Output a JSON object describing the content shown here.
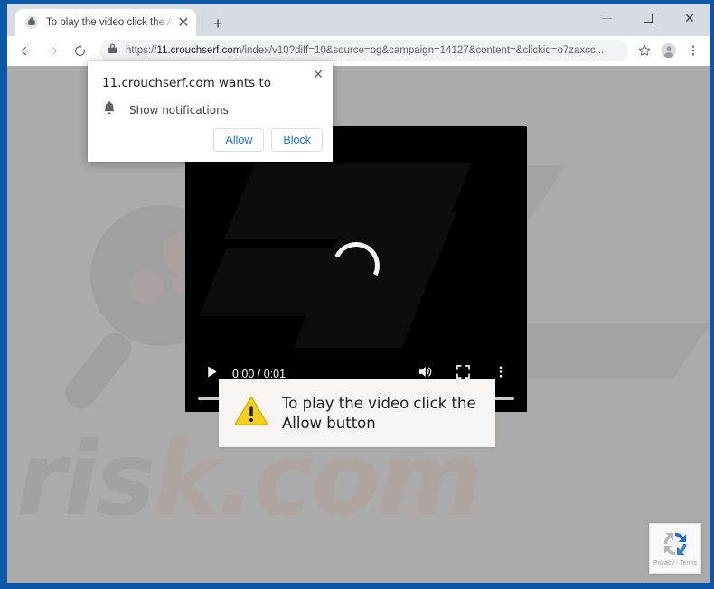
{
  "browser": {
    "tab": {
      "title": "To play the video click the Allow",
      "favicon": "globe-icon",
      "close_label": "✕"
    },
    "new_tab_label": "+",
    "window_controls": {
      "minimize": "minimize-icon",
      "maximize": "maximize-icon",
      "close": "✕"
    },
    "toolbar": {
      "back": "back-arrow-icon",
      "forward": "forward-arrow-icon",
      "reload": "reload-icon",
      "lock": "lock-icon",
      "url_scheme": "https://",
      "url_host": "11.crouchserf.com",
      "url_path": "/index/v10?diff=10&source=og&campaign=14127&content=&clickid=o7zaxcc...",
      "url_full": "https://11.crouchserf.com/index/v10?diff=10&source=og&campaign=14127&content=&clickid=o7zaxcc...",
      "bookmark": "star-icon",
      "profile": "profile-avatar-icon",
      "menu": "three-dot-menu-icon"
    }
  },
  "permission_dialog": {
    "title": "11.crouchserf.com wants to",
    "option_icon": "bell-icon",
    "option_label": "Show notifications",
    "allow_label": "Allow",
    "block_label": "Block",
    "close_label": "✕"
  },
  "video": {
    "play_icon": "play-icon",
    "time_display": "0:00 / 0:01",
    "current_time": "0:00",
    "duration": "0:01",
    "volume_icon": "volume-icon",
    "fullscreen_icon": "fullscreen-icon",
    "options_icon": "three-dot-vertical-icon",
    "spinner": "loading-spinner-icon",
    "progress_percent": 0
  },
  "message_box": {
    "icon": "warning-triangle-icon",
    "line1": "To play the video click the",
    "line2": "Allow button",
    "text": "To play the video click the Allow button"
  },
  "recaptcha": {
    "logo": "recaptcha-logo-icon",
    "terms": "Privacy - Terms"
  },
  "watermark": {
    "text_left": "ris",
    "text_right": "k.com",
    "full": "pcrisk.com",
    "glass_icon": "magnifying-glass-icon",
    "pc_letters": "PC"
  },
  "colors": {
    "window_frame": "#0b57a8",
    "page_background": "#ababab",
    "accent_blue": "#1a73e8",
    "warning_yellow": "#f5d020",
    "video_background": "#000000",
    "message_box_bg": "#f7f4f1"
  }
}
